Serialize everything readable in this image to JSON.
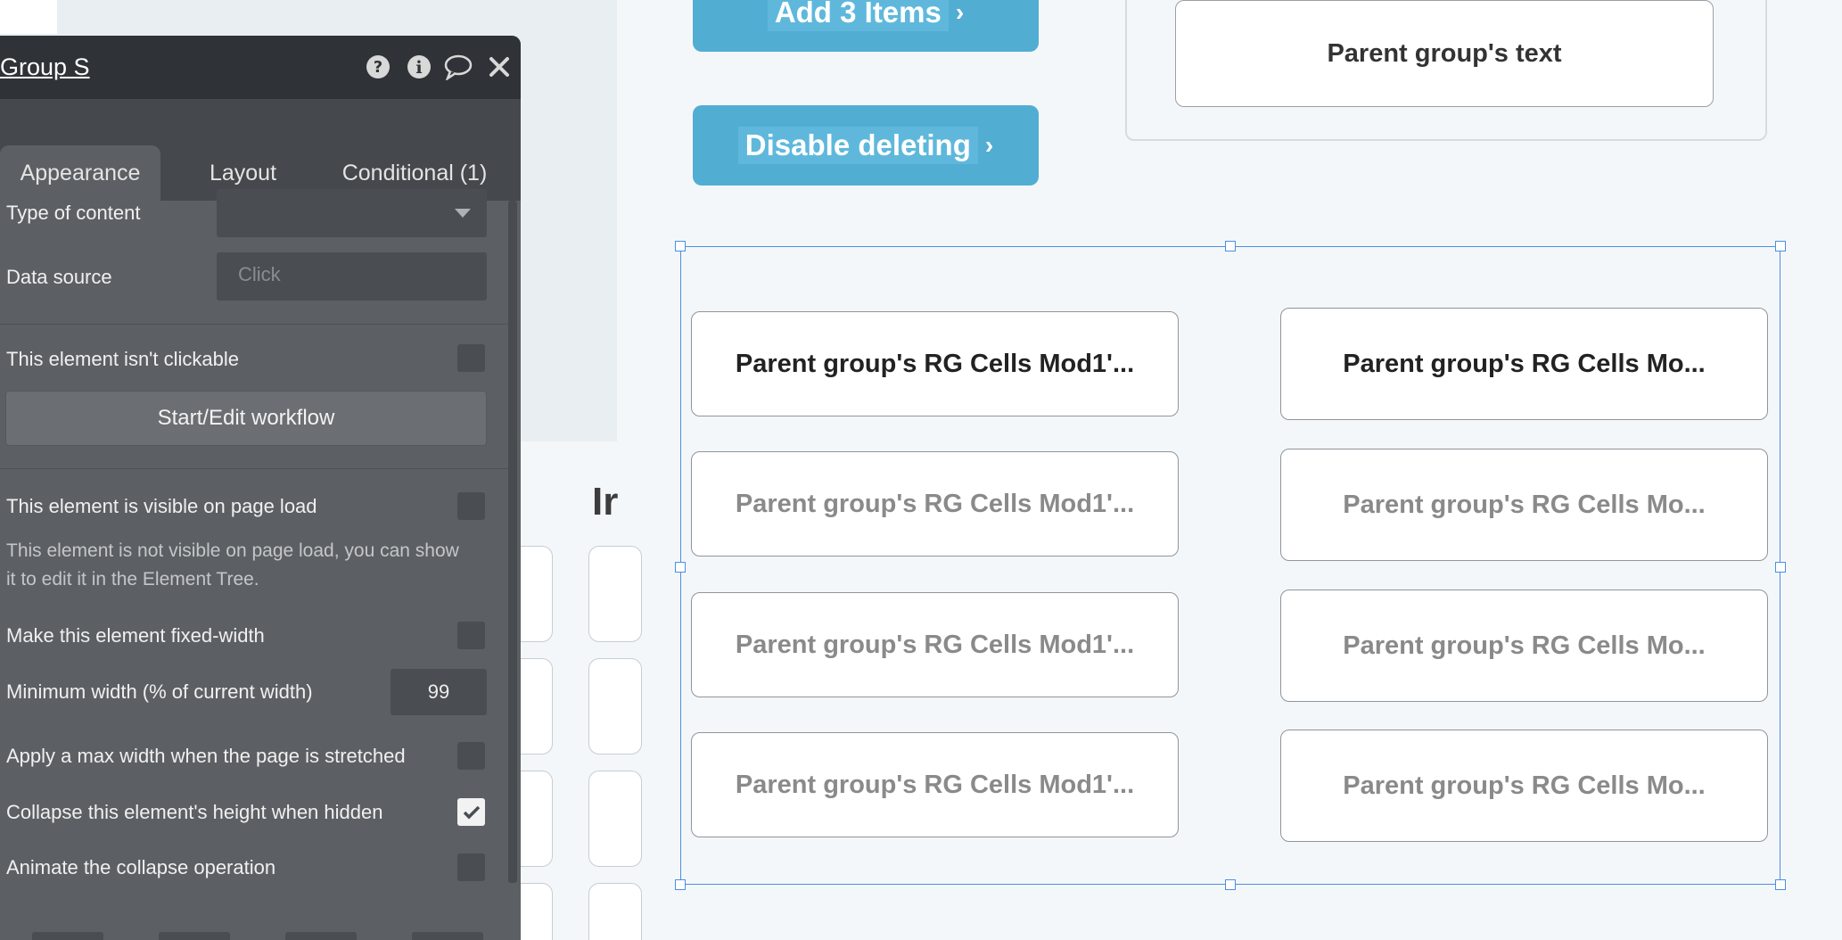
{
  "canvas": {
    "buttons": [
      {
        "label": "Add 3 Items",
        "chevron": "›"
      },
      {
        "label": "Disable deleting",
        "chevron": "›"
      }
    ],
    "heading_fragment": "Ir",
    "parent_text": "Parent group's text",
    "repeating_group": {
      "first_row": [
        "Parent group's RG Cells Mod1'...",
        "Parent group's RG Cells Mo..."
      ],
      "cells_left": [
        "Parent group's RG Cells Mod1'...",
        "Parent group's RG Cells Mod1'...",
        "Parent group's RG Cells Mod1'..."
      ],
      "cells_right": [
        "Parent group's RG Cells Mo...",
        "Parent group's RG Cells Mo...",
        "Parent group's RG Cells Mo..."
      ]
    }
  },
  "editor": {
    "title": "Group S",
    "header_icons": [
      "help-icon",
      "info-icon",
      "comment-icon",
      "close-icon"
    ],
    "tabs": [
      "Appearance",
      "Layout",
      "Conditional (1)"
    ],
    "active_tab": "Appearance",
    "type_of_content_label": "Type of content",
    "type_of_content_value": "",
    "data_source_label": "Data source",
    "data_source_placeholder": "Click",
    "not_clickable_label": "This element isn't clickable",
    "workflow_button": "Start/Edit workflow",
    "visible_on_load_label": "This element is visible on page load",
    "visibility_note": "This element is not visible on page load, you can show it to edit it in the Element Tree.",
    "fixed_width_label": "Make this element fixed-width",
    "min_width_label": "Minimum width (% of current width)",
    "min_width_value": "99",
    "max_width_label": "Apply a max width when the page is stretched",
    "collapse_label": "Collapse this element's height when hidden",
    "animate_label": "Animate the collapse operation",
    "checkboxes": {
      "not_clickable": false,
      "visible_on_load": false,
      "fixed_width": false,
      "max_width": false,
      "collapse": true,
      "animate": false
    }
  }
}
